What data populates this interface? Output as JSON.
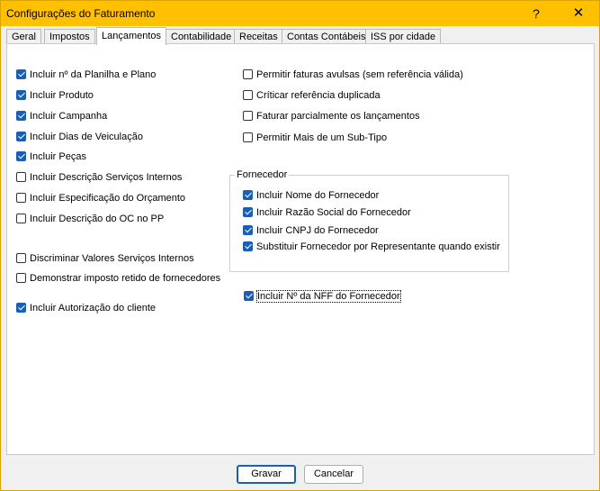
{
  "window": {
    "title": "Configurações do Faturamento",
    "help_glyph": "?",
    "close_glyph": "✕",
    "accent": "#ffc000"
  },
  "tabs": [
    {
      "label": "Geral",
      "active": false
    },
    {
      "label": "Impostos",
      "active": false
    },
    {
      "label": "Lançamentos",
      "active": true
    },
    {
      "label": "Contabilidade",
      "active": false
    },
    {
      "label": "Receitas",
      "active": false
    },
    {
      "label": "Contas Contábeis",
      "active": false
    },
    {
      "label": "ISS por cidade",
      "active": false
    }
  ],
  "left_options": [
    {
      "label": "Incluir nº da Planilha e Plano",
      "checked": true
    },
    {
      "label": "Incluir Produto",
      "checked": true
    },
    {
      "label": "Incluir Campanha",
      "checked": true
    },
    {
      "label": "Incluir Dias de Veiculação",
      "checked": true
    },
    {
      "label": "Incluir Peças",
      "checked": true
    },
    {
      "label": "Incluir Descrição Serviços Internos",
      "checked": false
    },
    {
      "label": "Incluir Especificação do Orçamento",
      "checked": false
    },
    {
      "label": "Incluir Descrição do OC no PP",
      "checked": false
    },
    {
      "label": "Discriminar Valores Serviços Internos",
      "checked": false
    },
    {
      "label": "Demonstrar imposto retido de fornecedores",
      "checked": false
    },
    {
      "label": "Incluir Autorização do cliente",
      "checked": true
    }
  ],
  "right_options": [
    {
      "label": "Permitir faturas avulsas (sem referência válida)",
      "checked": false
    },
    {
      "label": "Críticar referência duplicada",
      "checked": false
    },
    {
      "label": "Faturar parcialmente os lançamentos",
      "checked": false
    },
    {
      "label": "Permitir Mais de um Sub-Tipo",
      "checked": false
    }
  ],
  "fornecedor": {
    "label": "Fornecedor",
    "options": [
      {
        "label": "Incluir Nome do Fornecedor",
        "checked": true
      },
      {
        "label": "Incluir Razão Social do Fornecedor",
        "checked": true
      },
      {
        "label": "Incluir CNPJ do Fornecedor",
        "checked": true
      },
      {
        "label": "Substituir Fornecedor por Representante quando existir",
        "checked": true
      }
    ]
  },
  "nff_option": {
    "label": "Incluir Nº da NFF do Fornecedor",
    "checked": true
  },
  "buttons": {
    "save": "Gravar",
    "cancel": "Cancelar"
  }
}
